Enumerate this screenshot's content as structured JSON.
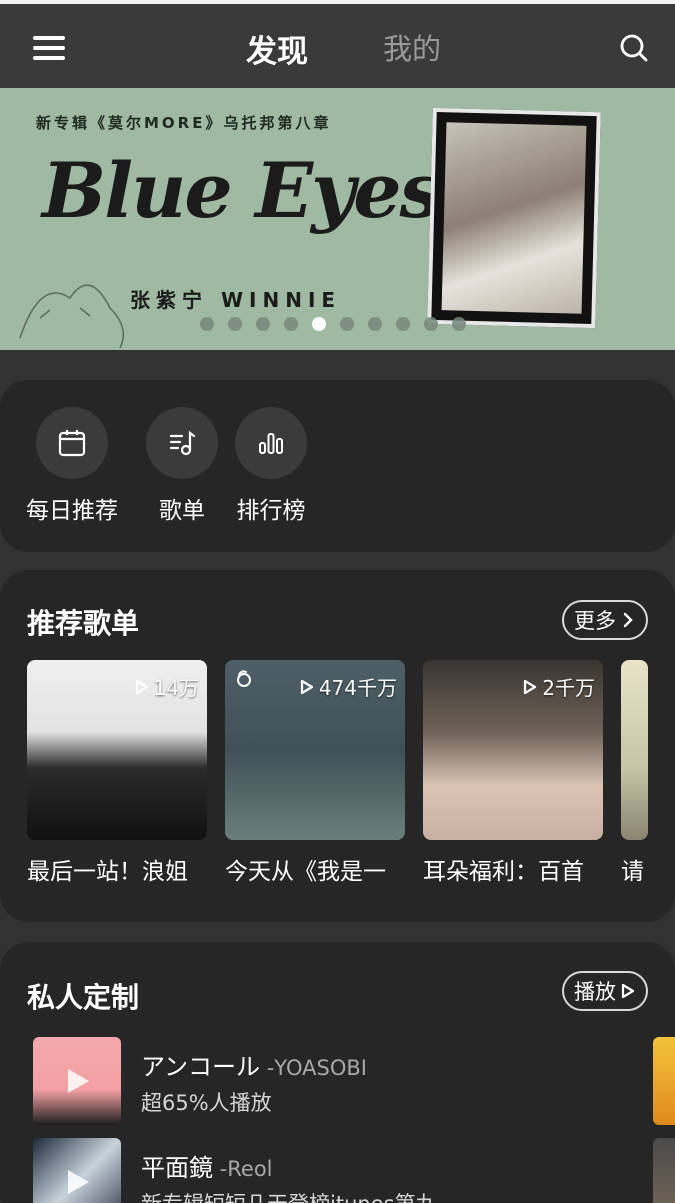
{
  "header": {
    "tab_discover": "发现",
    "tab_mine": "我的",
    "menu_icon": "menu-icon",
    "search_icon": "search-icon"
  },
  "banner": {
    "subtitle": "新专辑《莫尔MORE》乌托邦第八章",
    "title": "Blue Eyes",
    "artist": "张紫宁 WINNIE",
    "dots_total": 10,
    "active_dot": 5
  },
  "shortcuts": [
    {
      "label": "每日推荐",
      "icon": "calendar-icon"
    },
    {
      "label": "歌单",
      "icon": "playlist-icon"
    },
    {
      "label": "排行榜",
      "icon": "chart-icon"
    }
  ],
  "playlists": {
    "title": "推荐歌单",
    "more_label": "更多",
    "items": [
      {
        "count": "14万",
        "name": "最后一站！浪姐"
      },
      {
        "count": "474千万",
        "name": "今天从《我是一"
      },
      {
        "count": "2千万",
        "name": "耳朵福利：百首"
      },
      {
        "count": "",
        "name": "请"
      }
    ]
  },
  "personal": {
    "title": "私人定制",
    "play_label": "播放",
    "songs": [
      {
        "title": "アンコール",
        "artist": " -YOASOBI",
        "desc": "超65%人播放"
      },
      {
        "title": "平面鏡",
        "artist": " -Reol",
        "desc": "新专辑短短几天登榜itunes第九"
      }
    ]
  },
  "colors": {
    "background": "#323232",
    "card": "#262626",
    "header": "#3a3a3a",
    "banner": "#9fb9a2"
  }
}
